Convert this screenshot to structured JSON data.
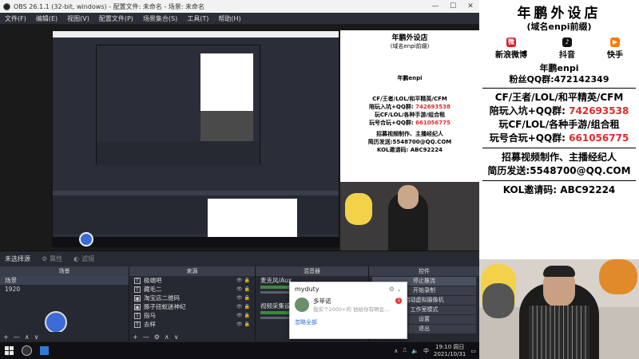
{
  "obs": {
    "title": "OBS 26.1.1 (32-bit, windows) - 配置文件: 未命名 - 场景: 未命名",
    "menu": [
      "文件(F)",
      "编辑(E)",
      "视图(V)",
      "配置文件(P)",
      "场景集合(S)",
      "工具(T)",
      "帮助(H)"
    ],
    "status_text": "未选择源",
    "props_label": "属性",
    "filters_label": "滤镜",
    "docks": {
      "scenes": {
        "title": "场景",
        "items": [
          "场景",
          "1920"
        ]
      },
      "sources": {
        "title": "来源",
        "items": [
          "极端吧",
          "藏毛二",
          "淘宝店二维码",
          "豚子扭蚁迷神纪",
          "指马",
          "去样"
        ]
      },
      "mixer": {
        "title": "混音器",
        "channels": [
          {
            "name": "麦克风/Aux"
          },
          {
            "name": "视频采集设备"
          }
        ]
      },
      "controls": {
        "title": "控件",
        "buttons": [
          "停止推流",
          "开始录制",
          "启动虚拟摄像机",
          "工作室模式",
          "设置",
          "退出"
        ]
      }
    },
    "popup": {
      "app": "myduty",
      "sender": "多苹诺",
      "snippet": "我买个2000+的  他给你有啊会...",
      "badge": "1",
      "link": "忽略全部"
    }
  },
  "taskbar": {
    "time": "19:10 周日",
    "date": "2021/10/31",
    "lang": "中"
  },
  "poster": {
    "title": "年鹏外设店",
    "subtitle": "(域名enpi前缀)",
    "social": [
      {
        "label": "新浪微博",
        "icon": "weibo-icon",
        "color": "#e6162d"
      },
      {
        "label": "抖音",
        "icon": "douyin-icon",
        "color": "#111111"
      },
      {
        "label": "快手",
        "icon": "kuaishou-icon",
        "color": "#ff7a00"
      }
    ],
    "handle": "年鹏enpi",
    "fans_group_label": "粉丝QQ群:",
    "fans_group": "472142349",
    "lines": [
      {
        "text": "CF/王者/LOL/和平精英/CFM",
        "red": ""
      },
      {
        "text": "陪玩入坑+QQ群: ",
        "red": "742693538"
      },
      {
        "text": "玩CF/LOL/各种手游/组合租",
        "red": ""
      },
      {
        "text": "玩号合玩+QQ群: ",
        "red": "661056775"
      }
    ],
    "recruit": "招募视频制作、主播经纪人",
    "resume": "简历发送:5548700@QQ.COM",
    "kol": "KOL邀请码: ABC92224"
  },
  "colors": {
    "accent": "#e02a2a",
    "obs_bg": "#2b2e38"
  }
}
